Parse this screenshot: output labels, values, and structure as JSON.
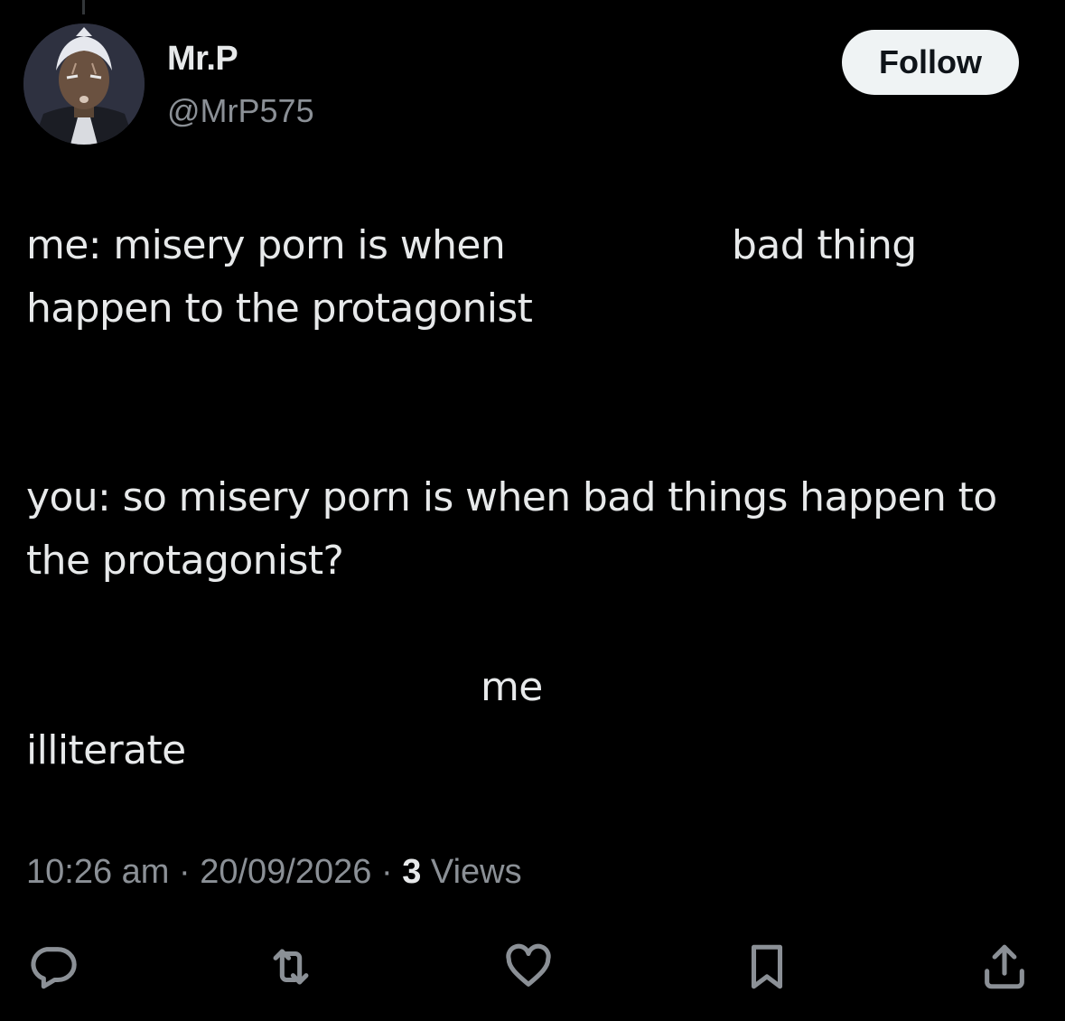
{
  "author": {
    "display_name": "Mr.P",
    "handle": "@MrP575",
    "avatar_icon": "anime-character-avatar"
  },
  "follow_label": "Follow",
  "tweet": {
    "line1_left": "me: misery porn is when",
    "line1_right": "bad thing",
    "line2": "happen to the protagonist",
    "line3": "you: so misery porn is when bad things happen to",
    "line4": "the protagonist?",
    "line5": "me",
    "line6": "illiterate"
  },
  "meta": {
    "time": "10:26 am",
    "separator": " · ",
    "date": "20/09/2026",
    "views_count": "3",
    "views_label": "Views"
  },
  "actions": {
    "reply_icon": "reply-icon",
    "retweet_icon": "retweet-icon",
    "like_icon": "heart-icon",
    "bookmark_icon": "bookmark-icon",
    "share_icon": "share-icon"
  },
  "colors": {
    "background": "#000000",
    "text": "#e7e9ea",
    "secondary_text": "#8b9096",
    "follow_bg": "#eff3f4"
  }
}
